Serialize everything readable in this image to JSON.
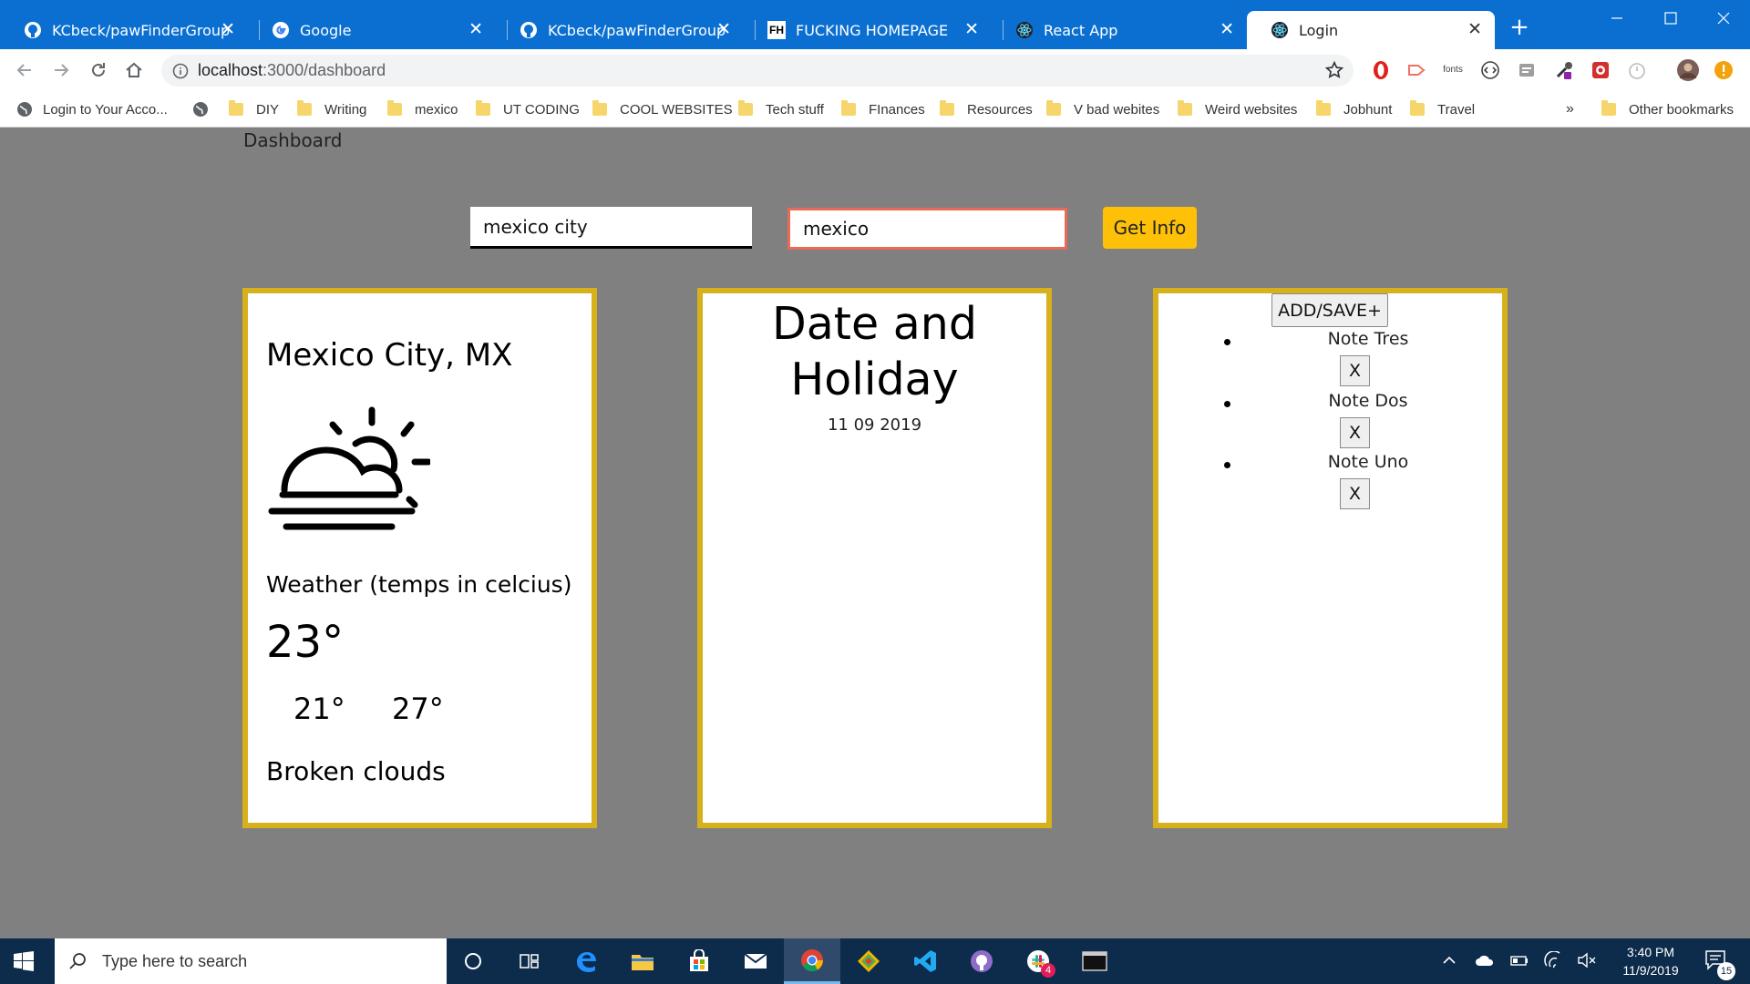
{
  "browser": {
    "tabs": [
      {
        "title": "KCbeck/pawFinderGroup",
        "icon": "github-icon"
      },
      {
        "title": "Google",
        "icon": "google-icon"
      },
      {
        "title": "KCbeck/pawFinderGroup",
        "icon": "github-icon"
      },
      {
        "title": "FUCKING HOMEPAGE",
        "icon": "fh-icon",
        "icon_text": "FH"
      },
      {
        "title": "React App",
        "icon": "react-icon"
      },
      {
        "title": "Login",
        "icon": "react-icon",
        "active": true
      }
    ],
    "close_glyph": "✕",
    "new_tab_glyph": "+",
    "url": {
      "host": "localhost",
      "path": ":3000/dashboard"
    },
    "bookmarks": [
      "Login to Your Acco...",
      "DIY",
      "Writing",
      "mexico",
      "UT CODING",
      "COOL WEBSITES",
      "Tech stuff",
      "FInances",
      "Resources",
      "V bad webites",
      "Weird websites",
      "Jobhunt",
      "Travel"
    ],
    "bookmarks_overflow": "»",
    "other_bookmarks": "Other bookmarks",
    "ext_fonts_label": "fonts"
  },
  "page": {
    "title": "Dashboard",
    "city_input_value": "mexico city",
    "country_input_value": "mexico",
    "get_info_label": "Get Info"
  },
  "weather": {
    "city": "Mexico City, MX",
    "icon": "sun-behind-clouds-fog-icon",
    "label": "Weather (temps in celcius)",
    "temp": "23°",
    "temp_min": "21°",
    "temp_max": "27°",
    "description": "Broken clouds"
  },
  "date_card": {
    "title": "Date and Holiday",
    "date": "11 09 2019"
  },
  "notes": {
    "add_label": "ADD/SAVE+",
    "items": [
      "Note Tres",
      "Note Dos",
      "Note Uno"
    ],
    "delete_label": "X"
  },
  "taskbar": {
    "search_placeholder": "Type here to search",
    "time": "3:40 PM",
    "date": "11/9/2019",
    "notification_count": "15",
    "slack_badge": "4"
  },
  "colors": {
    "tab_bar": "#0a6fd1",
    "page_bg": "#808080",
    "card_border": "#d6b11c",
    "button_yellow": "#ffc107",
    "input_focus_border": "#e96a55",
    "taskbar": "#0d2b4a"
  }
}
